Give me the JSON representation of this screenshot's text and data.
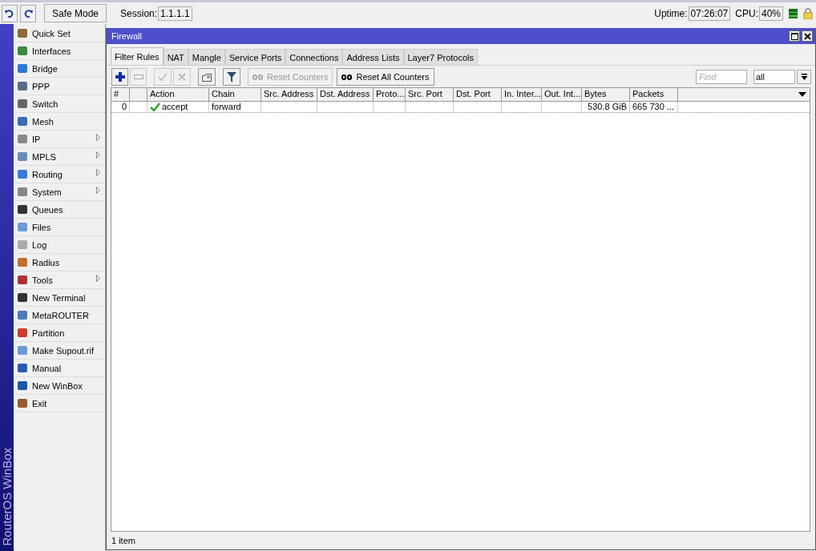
{
  "top_bar": {
    "safe_mode_button": "Safe Mode",
    "session_label": "Session:",
    "session_value": "1.1.1.1",
    "uptime_label": "Uptime:",
    "uptime_value": "07:26:07",
    "cpu_label": "CPU:",
    "cpu_value": "40%"
  },
  "brand": "RouterOS WinBox",
  "sidebar": {
    "items": [
      {
        "label": "Quick Set",
        "submenu": false
      },
      {
        "label": "Interfaces",
        "submenu": false
      },
      {
        "label": "Bridge",
        "submenu": false
      },
      {
        "label": "PPP",
        "submenu": false
      },
      {
        "label": "Switch",
        "submenu": false
      },
      {
        "label": "Mesh",
        "submenu": false
      },
      {
        "label": "IP",
        "submenu": true
      },
      {
        "label": "MPLS",
        "submenu": true
      },
      {
        "label": "Routing",
        "submenu": true
      },
      {
        "label": "System",
        "submenu": true
      },
      {
        "label": "Queues",
        "submenu": false
      },
      {
        "label": "Files",
        "submenu": false
      },
      {
        "label": "Log",
        "submenu": false
      },
      {
        "label": "Radius",
        "submenu": false
      },
      {
        "label": "Tools",
        "submenu": true
      },
      {
        "label": "New Terminal",
        "submenu": false
      },
      {
        "label": "MetaROUTER",
        "submenu": false
      },
      {
        "label": "Partition",
        "submenu": false
      },
      {
        "label": "Make Supout.rif",
        "submenu": false
      },
      {
        "label": "Manual",
        "submenu": false
      },
      {
        "label": "New WinBox",
        "submenu": false
      },
      {
        "label": "Exit",
        "submenu": false
      }
    ]
  },
  "window": {
    "title": "Firewall",
    "tabs": [
      {
        "label": "Filter Rules",
        "selected": true
      },
      {
        "label": "NAT",
        "selected": false
      },
      {
        "label": "Mangle",
        "selected": false
      },
      {
        "label": "Service Ports",
        "selected": false
      },
      {
        "label": "Connections",
        "selected": false
      },
      {
        "label": "Address Lists",
        "selected": false
      },
      {
        "label": "Layer7 Protocols",
        "selected": false
      }
    ],
    "toolbar": {
      "icon_buttons": [
        {
          "kind": "add",
          "disabled": false
        },
        {
          "kind": "remove",
          "disabled": true
        },
        {
          "kind": "enable",
          "disabled": true
        },
        {
          "kind": "disable",
          "disabled": true
        },
        {
          "kind": "comment",
          "disabled": false
        },
        {
          "kind": "filter",
          "disabled": false
        }
      ],
      "text_buttons": [
        {
          "label": "Reset Counters",
          "disabled": true
        },
        {
          "label": "Reset All Counters",
          "disabled": false
        }
      ],
      "find_placeholder": "Find",
      "filter_value": "all"
    },
    "table": {
      "columns": [
        "#",
        "Action",
        "Chain",
        "Src. Address",
        "Dst. Address",
        "Proto...",
        "Src. Port",
        "Dst. Port",
        "In. Inter...",
        "Out. Int...",
        "Bytes",
        "Packets"
      ],
      "rows": [
        {
          "number": "0",
          "action": "accept",
          "chain": "forward",
          "bytes": "530.8 GiB",
          "packets": "665 730 ...",
          "selected": false
        }
      ]
    },
    "status_bar": "1 item"
  }
}
